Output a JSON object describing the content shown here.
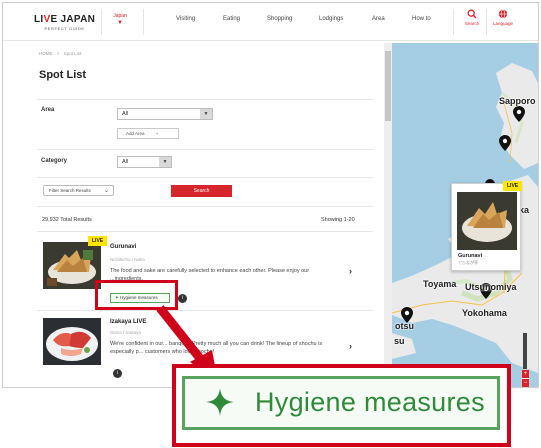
{
  "header": {
    "logo_main_1": "LI",
    "logo_main_hl": "V",
    "logo_main_2": "E JAPAN",
    "logo_sub": "PERFECT GUIDE",
    "region_label": "Japan",
    "region_arrow": "▼",
    "nav": [
      "Visiting",
      "Eating",
      "Shopping",
      "Lodgings",
      "Area",
      "How to"
    ],
    "search_label": "Search",
    "language_label": "Language"
  },
  "breadcrumb": {
    "home": "HOME",
    "sep": ">",
    "current": "Spot List"
  },
  "page_title": "Spot List",
  "filters": {
    "area_label": "Area",
    "area_value": "All",
    "add_area_label": "Add Area",
    "add_area_plus": "+",
    "category_label": "Category",
    "category_value": "All",
    "filter_results_label": "Filter Search Results",
    "search_button": "Search"
  },
  "results": {
    "total": "29,932 Total Results",
    "showing": "Showing 1-20"
  },
  "cards": [
    {
      "badge": "LIVE",
      "title": "Gurunavi",
      "subtitle": "Nishikicho / Naka",
      "description": "The food and sake are carefully selected to enhance each other. Please enjoy our ...ingredients.",
      "hygiene_label": "Hygiene measures",
      "chevron": "›"
    },
    {
      "title": "Izakaya LIVE",
      "subtitle": "Ginza / Izakaya",
      "description": "We're confident in our... banquet! Pretty much all you can drink! The lineup of shochu is especially p... customers who love shochu!",
      "chevron": "›"
    }
  ],
  "hygiene_zoom": {
    "star": "✦",
    "label": "Hygiene measures"
  },
  "map": {
    "labels": {
      "sapporo": "Sapporo",
      "toyama": "Toyama",
      "utsunomiya": "Utsunomiya",
      "yokohama": "Yokohama",
      "osaka_partial": "otsu",
      "su_partial": "su",
      "ka_partial": "ka"
    },
    "popup": {
      "badge": "LIVE",
      "title": "Gurunavi",
      "subtitle": "てらなが亭"
    },
    "zoom_in": "+",
    "zoom_out": "−"
  },
  "colors": {
    "brand_red": "#d7262b",
    "highlight_red": "#d0021b",
    "hygiene_green": "#2f8a3a",
    "live_yellow": "#ffe600"
  }
}
